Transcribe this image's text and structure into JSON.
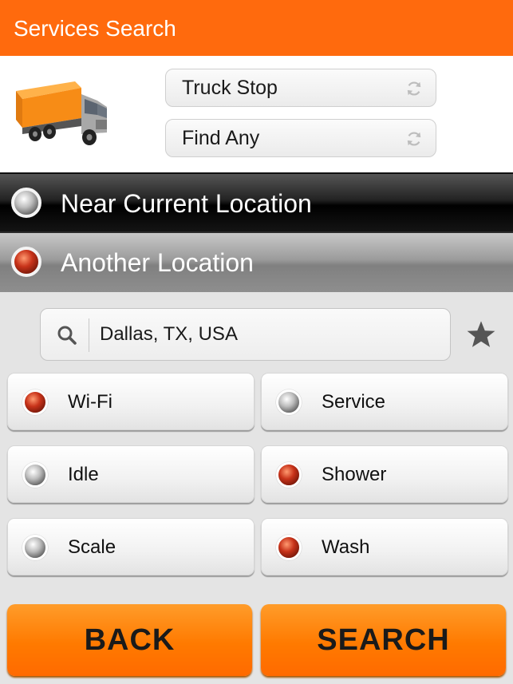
{
  "header": {
    "title": "Services Search"
  },
  "selectors": [
    {
      "value": "Truck Stop",
      "icon": "refresh-icon"
    },
    {
      "value": "Find Any",
      "icon": "refresh-icon"
    }
  ],
  "location_options": [
    {
      "label": "Near Current Location",
      "selected": false
    },
    {
      "label": "Another Location",
      "selected": true
    }
  ],
  "search": {
    "value": "Dallas, TX, USA",
    "icon": "search-icon",
    "favorite_icon": "star-icon"
  },
  "filters": [
    {
      "label": "Wi-Fi",
      "selected": true
    },
    {
      "label": "Service",
      "selected": false
    },
    {
      "label": "Idle",
      "selected": false
    },
    {
      "label": "Shower",
      "selected": true
    },
    {
      "label": "Scale",
      "selected": false
    },
    {
      "label": "Wash",
      "selected": true
    }
  ],
  "buttons": {
    "back": "BACK",
    "search": "SEARCH"
  },
  "colors": {
    "accent": "#ff6a0d",
    "radio_on": "#c8331a"
  }
}
